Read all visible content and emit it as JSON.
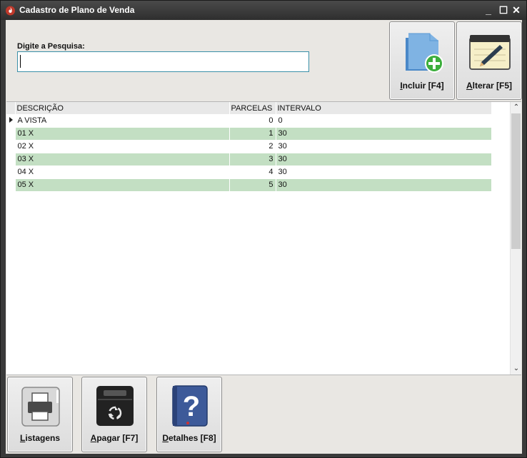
{
  "window": {
    "title": "Cadastro de Plano de Venda",
    "minimize": "_",
    "maximize": "☐",
    "close": "✕"
  },
  "search": {
    "label": "Digite a Pesquisa:",
    "value": "",
    "placeholder": ""
  },
  "toolbar": {
    "incluir": {
      "key": "I",
      "rest": "ncluir [F4]",
      "icon": "folder-add-icon"
    },
    "alterar": {
      "key": "A",
      "rest": "lterar [F5]",
      "icon": "notepad-pencil-icon"
    }
  },
  "grid": {
    "columns": [
      "DESCRIÇÃO",
      "PARCELAS",
      "INTERVALO"
    ],
    "rows": [
      {
        "descricao": "A VISTA",
        "parcelas": "0",
        "intervalo": "0",
        "selected": true
      },
      {
        "descricao": "01 X",
        "parcelas": "1",
        "intervalo": "30"
      },
      {
        "descricao": "02 X",
        "parcelas": "2",
        "intervalo": "30"
      },
      {
        "descricao": "03 X",
        "parcelas": "3",
        "intervalo": "30"
      },
      {
        "descricao": "04 X",
        "parcelas": "4",
        "intervalo": "30"
      },
      {
        "descricao": "05 X",
        "parcelas": "5",
        "intervalo": "30"
      }
    ]
  },
  "bottom_buttons": {
    "listagens": {
      "key": "L",
      "rest": "istagens",
      "icon": "printer-icon"
    },
    "apagar": {
      "key": "A",
      "rest": "pagar [F7]",
      "icon": "recycle-bin-icon"
    },
    "detalhes": {
      "key": "D",
      "rest": "etalhes [F8]",
      "icon": "help-book-icon"
    }
  },
  "colors": {
    "row_alt": "#c3dfc3",
    "input_border": "#3a8fa8",
    "titlebar": "#3a3a3a"
  }
}
